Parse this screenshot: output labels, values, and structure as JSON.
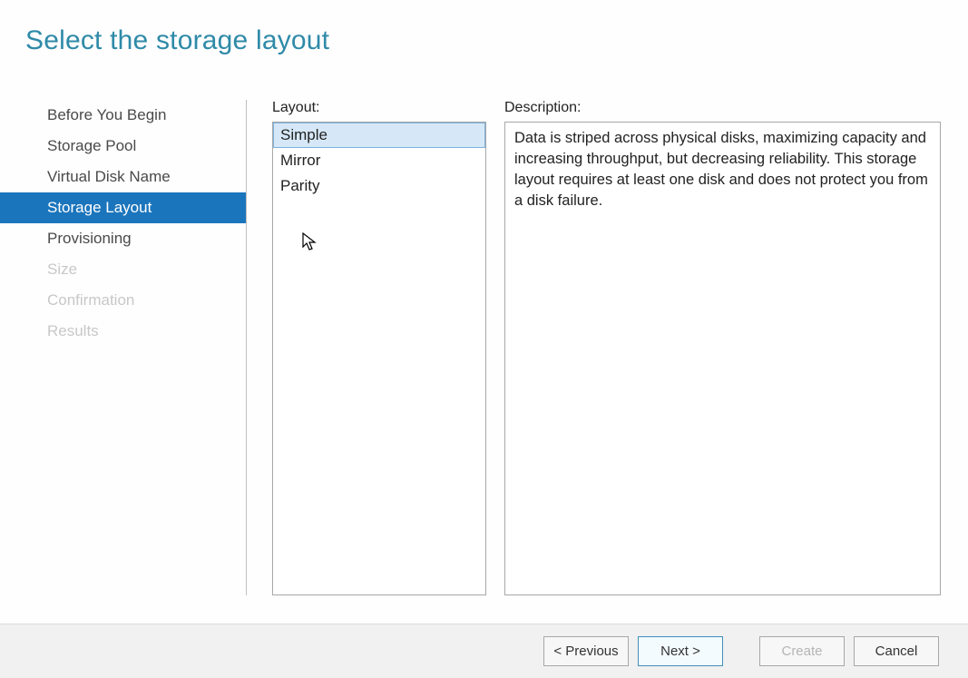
{
  "header": {
    "title": "Select the storage layout"
  },
  "sidebar": {
    "items": [
      {
        "label": "Before You Begin",
        "state": "normal"
      },
      {
        "label": "Storage Pool",
        "state": "normal"
      },
      {
        "label": "Virtual Disk Name",
        "state": "normal"
      },
      {
        "label": "Storage Layout",
        "state": "selected"
      },
      {
        "label": "Provisioning",
        "state": "normal"
      },
      {
        "label": "Size",
        "state": "disabled"
      },
      {
        "label": "Confirmation",
        "state": "disabled"
      },
      {
        "label": "Results",
        "state": "disabled"
      }
    ]
  },
  "main": {
    "layout_label": "Layout:",
    "layouts": [
      {
        "label": "Simple",
        "selected": true
      },
      {
        "label": "Mirror",
        "selected": false
      },
      {
        "label": "Parity",
        "selected": false
      }
    ],
    "description_label": "Description:",
    "description_text": "Data is striped across physical disks, maximizing capacity and increasing throughput, but decreasing reliability. This storage layout requires at least one disk and does not protect you from a disk failure."
  },
  "footer": {
    "previous": "< Previous",
    "next": "Next >",
    "create": "Create",
    "cancel": "Cancel",
    "create_enabled": false
  }
}
